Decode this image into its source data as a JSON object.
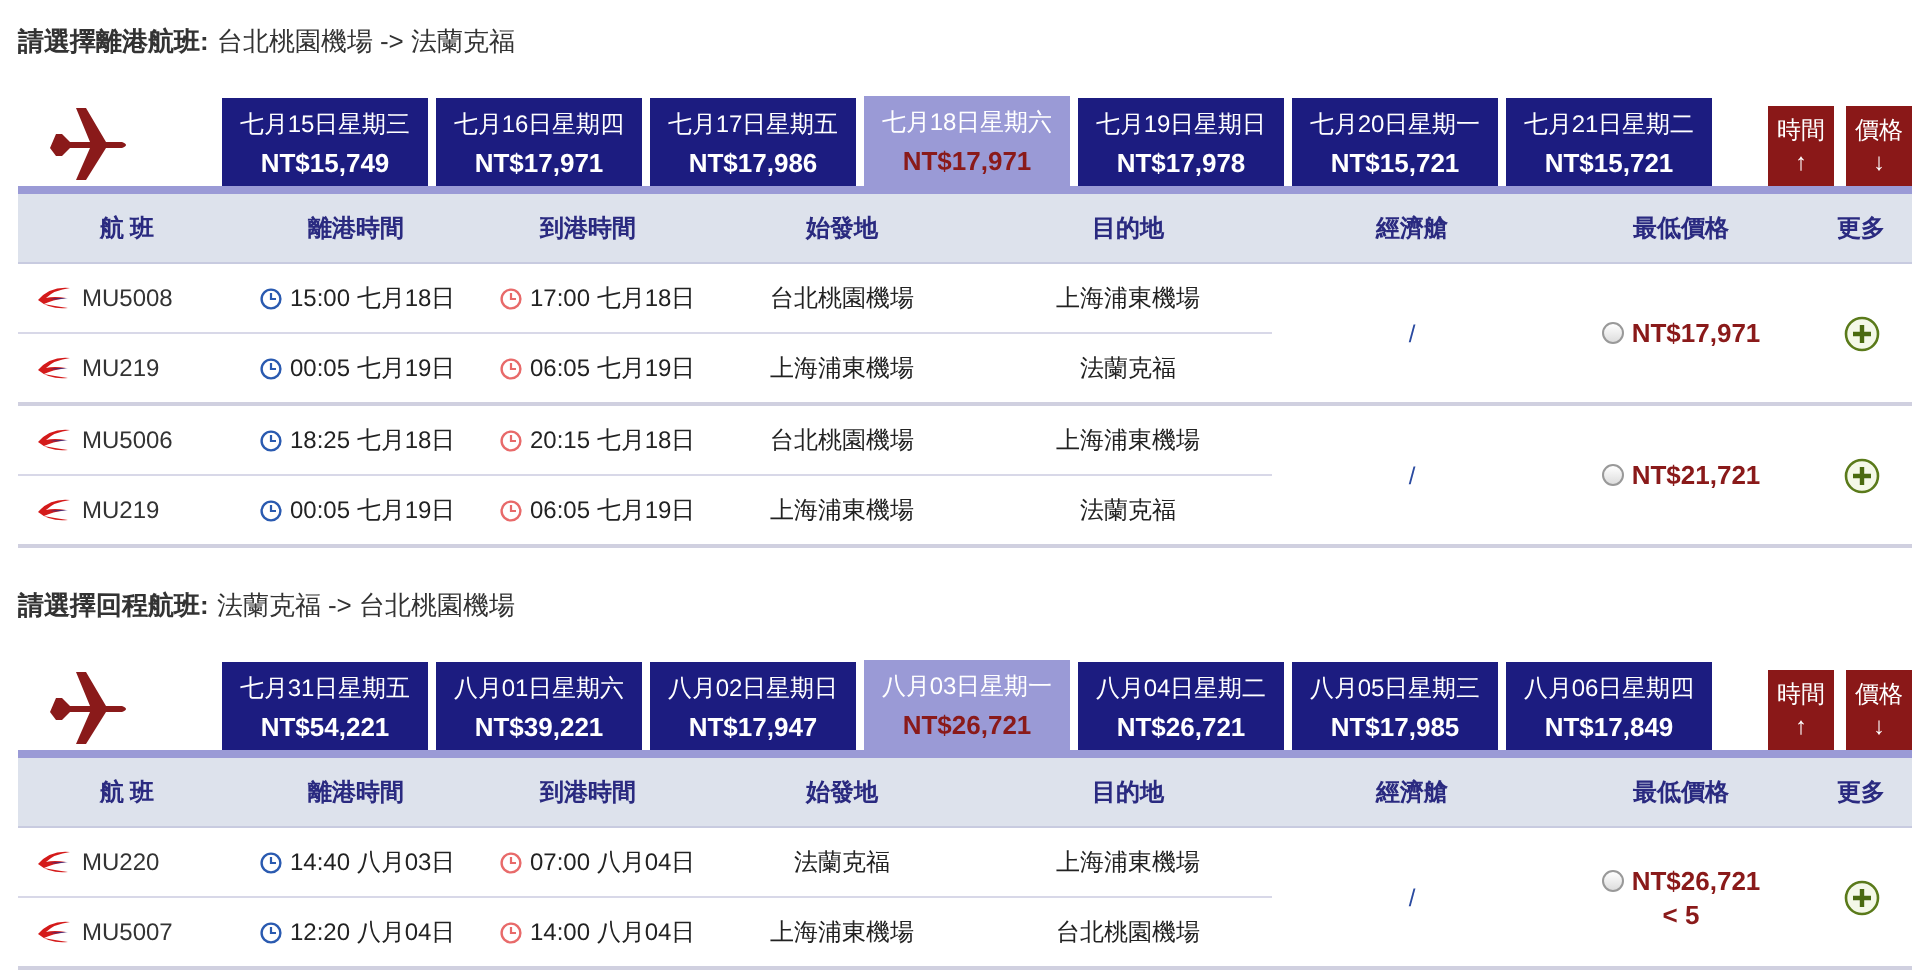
{
  "sections": [
    {
      "heading": {
        "label": "請選擇離港航班:",
        "route": "台北桃園機場 -> 法蘭克福"
      },
      "dates": [
        {
          "date": "七月15日星期三",
          "price": "NT$15,749",
          "selected": false
        },
        {
          "date": "七月16日星期四",
          "price": "NT$17,971",
          "selected": false
        },
        {
          "date": "七月17日星期五",
          "price": "NT$17,986",
          "selected": false
        },
        {
          "date": "七月18日星期六",
          "price": "NT$17,971",
          "selected": true
        },
        {
          "date": "七月19日星期日",
          "price": "NT$17,978",
          "selected": false
        },
        {
          "date": "七月20日星期一",
          "price": "NT$15,721",
          "selected": false
        },
        {
          "date": "七月21日星期二",
          "price": "NT$15,721",
          "selected": false
        }
      ],
      "sort_buttons": [
        {
          "label": "時間",
          "arrow": "↑"
        },
        {
          "label": "價格",
          "arrow": "↓"
        }
      ],
      "columns": [
        "航 班",
        "離港時間",
        "到港時間",
        "始發地",
        "目的地",
        "經濟艙",
        "最低價格",
        "更多"
      ],
      "itineraries": [
        {
          "legs": [
            {
              "flight": "MU5008",
              "departure": "15:00 七月18日",
              "arrival": "17:00 七月18日",
              "origin": "台北桃園機場",
              "destination": "上海浦東機場"
            },
            {
              "flight": "MU219",
              "departure": "00:05 七月19日",
              "arrival": "06:05 七月19日",
              "origin": "上海浦東機場",
              "destination": "法蘭克福"
            }
          ],
          "cabin": "/",
          "price": "NT$17,971",
          "selected": false
        },
        {
          "legs": [
            {
              "flight": "MU5006",
              "departure": "18:25 七月18日",
              "arrival": "20:15 七月18日",
              "origin": "台北桃園機場",
              "destination": "上海浦東機場"
            },
            {
              "flight": "MU219",
              "departure": "00:05 七月19日",
              "arrival": "06:05 七月19日",
              "origin": "上海浦東機場",
              "destination": "法蘭克福"
            }
          ],
          "cabin": "/",
          "price": "NT$21,721",
          "selected": false
        }
      ]
    },
    {
      "heading": {
        "label": "請選擇回程航班:",
        "route": "法蘭克福 -> 台北桃園機場"
      },
      "dates": [
        {
          "date": "七月31日星期五",
          "price": "NT$54,221",
          "selected": false
        },
        {
          "date": "八月01日星期六",
          "price": "NT$39,221",
          "selected": false
        },
        {
          "date": "八月02日星期日",
          "price": "NT$17,947",
          "selected": false
        },
        {
          "date": "八月03日星期一",
          "price": "NT$26,721",
          "selected": true
        },
        {
          "date": "八月04日星期二",
          "price": "NT$26,721",
          "selected": false
        },
        {
          "date": "八月05日星期三",
          "price": "NT$17,985",
          "selected": false
        },
        {
          "date": "八月06日星期四",
          "price": "NT$17,849",
          "selected": false
        }
      ],
      "sort_buttons": [
        {
          "label": "時間",
          "arrow": "↑"
        },
        {
          "label": "價格",
          "arrow": "↓"
        }
      ],
      "columns": [
        "航 班",
        "離港時間",
        "到港時間",
        "始發地",
        "目的地",
        "經濟艙",
        "最低價格",
        "更多"
      ],
      "itineraries": [
        {
          "legs": [
            {
              "flight": "MU220",
              "departure": "14:40 八月03日",
              "arrival": "07:00 八月04日",
              "origin": "法蘭克福",
              "destination": "上海浦東機場"
            },
            {
              "flight": "MU5007",
              "departure": "12:20 八月04日",
              "arrival": "14:00 八月04日",
              "origin": "上海浦東機場",
              "destination": "台北桃園機場"
            }
          ],
          "cabin": "/",
          "price": "NT$26,721",
          "seats_left": "< 5",
          "selected": false
        }
      ]
    }
  ]
}
